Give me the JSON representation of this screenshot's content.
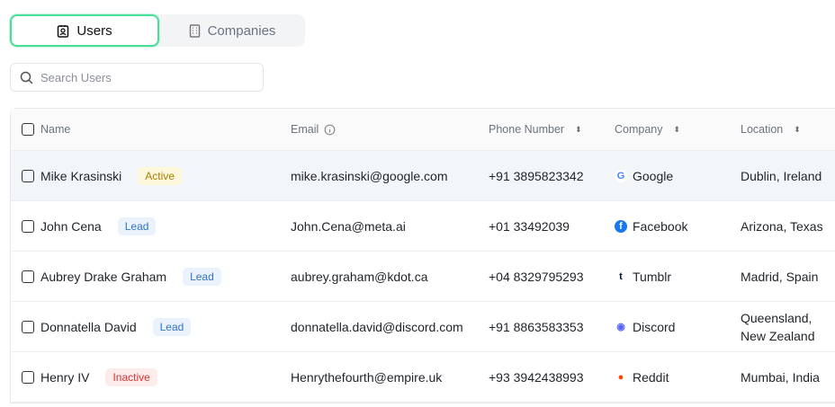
{
  "tabs": [
    {
      "label": "Users",
      "icon": "user-badge-icon",
      "active": true
    },
    {
      "label": "Companies",
      "icon": "building-icon",
      "active": false
    }
  ],
  "search": {
    "placeholder": "Search Users"
  },
  "columns": {
    "name": "Name",
    "email": "Email",
    "phone": "Phone Number",
    "company": "Company",
    "location": "Location"
  },
  "rows": [
    {
      "name": "Mike Krasinski",
      "status": "Active",
      "email": "mike.krasinski@google.com",
      "phone": "+91 3895823342",
      "company": "Google",
      "location": "Dublin, Ireland"
    },
    {
      "name": "John Cena",
      "status": "Lead",
      "email": "John.Cena@meta.ai",
      "phone": "+01 33492039",
      "company": "Facebook",
      "location": "Arizona, Texas"
    },
    {
      "name": "Aubrey Drake Graham",
      "status": "Lead",
      "email": "aubrey.graham@kdot.ca",
      "phone": "+04 8329795293",
      "company": "Tumblr",
      "location": "Madrid, Spain"
    },
    {
      "name": "Donnatella David",
      "status": "Lead",
      "email": "donnatella.david@discord.com",
      "phone": "+91 8863583353",
      "company": "Discord",
      "location": "Queensland, New Zealand"
    },
    {
      "name": "Henry IV",
      "status": "Inactive",
      "email": "Henrythefourth@empire.uk",
      "phone": "+93 3942438993",
      "company": "Reddit",
      "location": "Mumbai, India"
    }
  ],
  "colors": {
    "accent": "#4ade9a",
    "active": "#a77b06",
    "lead": "#3173c6",
    "inactive": "#d93434"
  }
}
